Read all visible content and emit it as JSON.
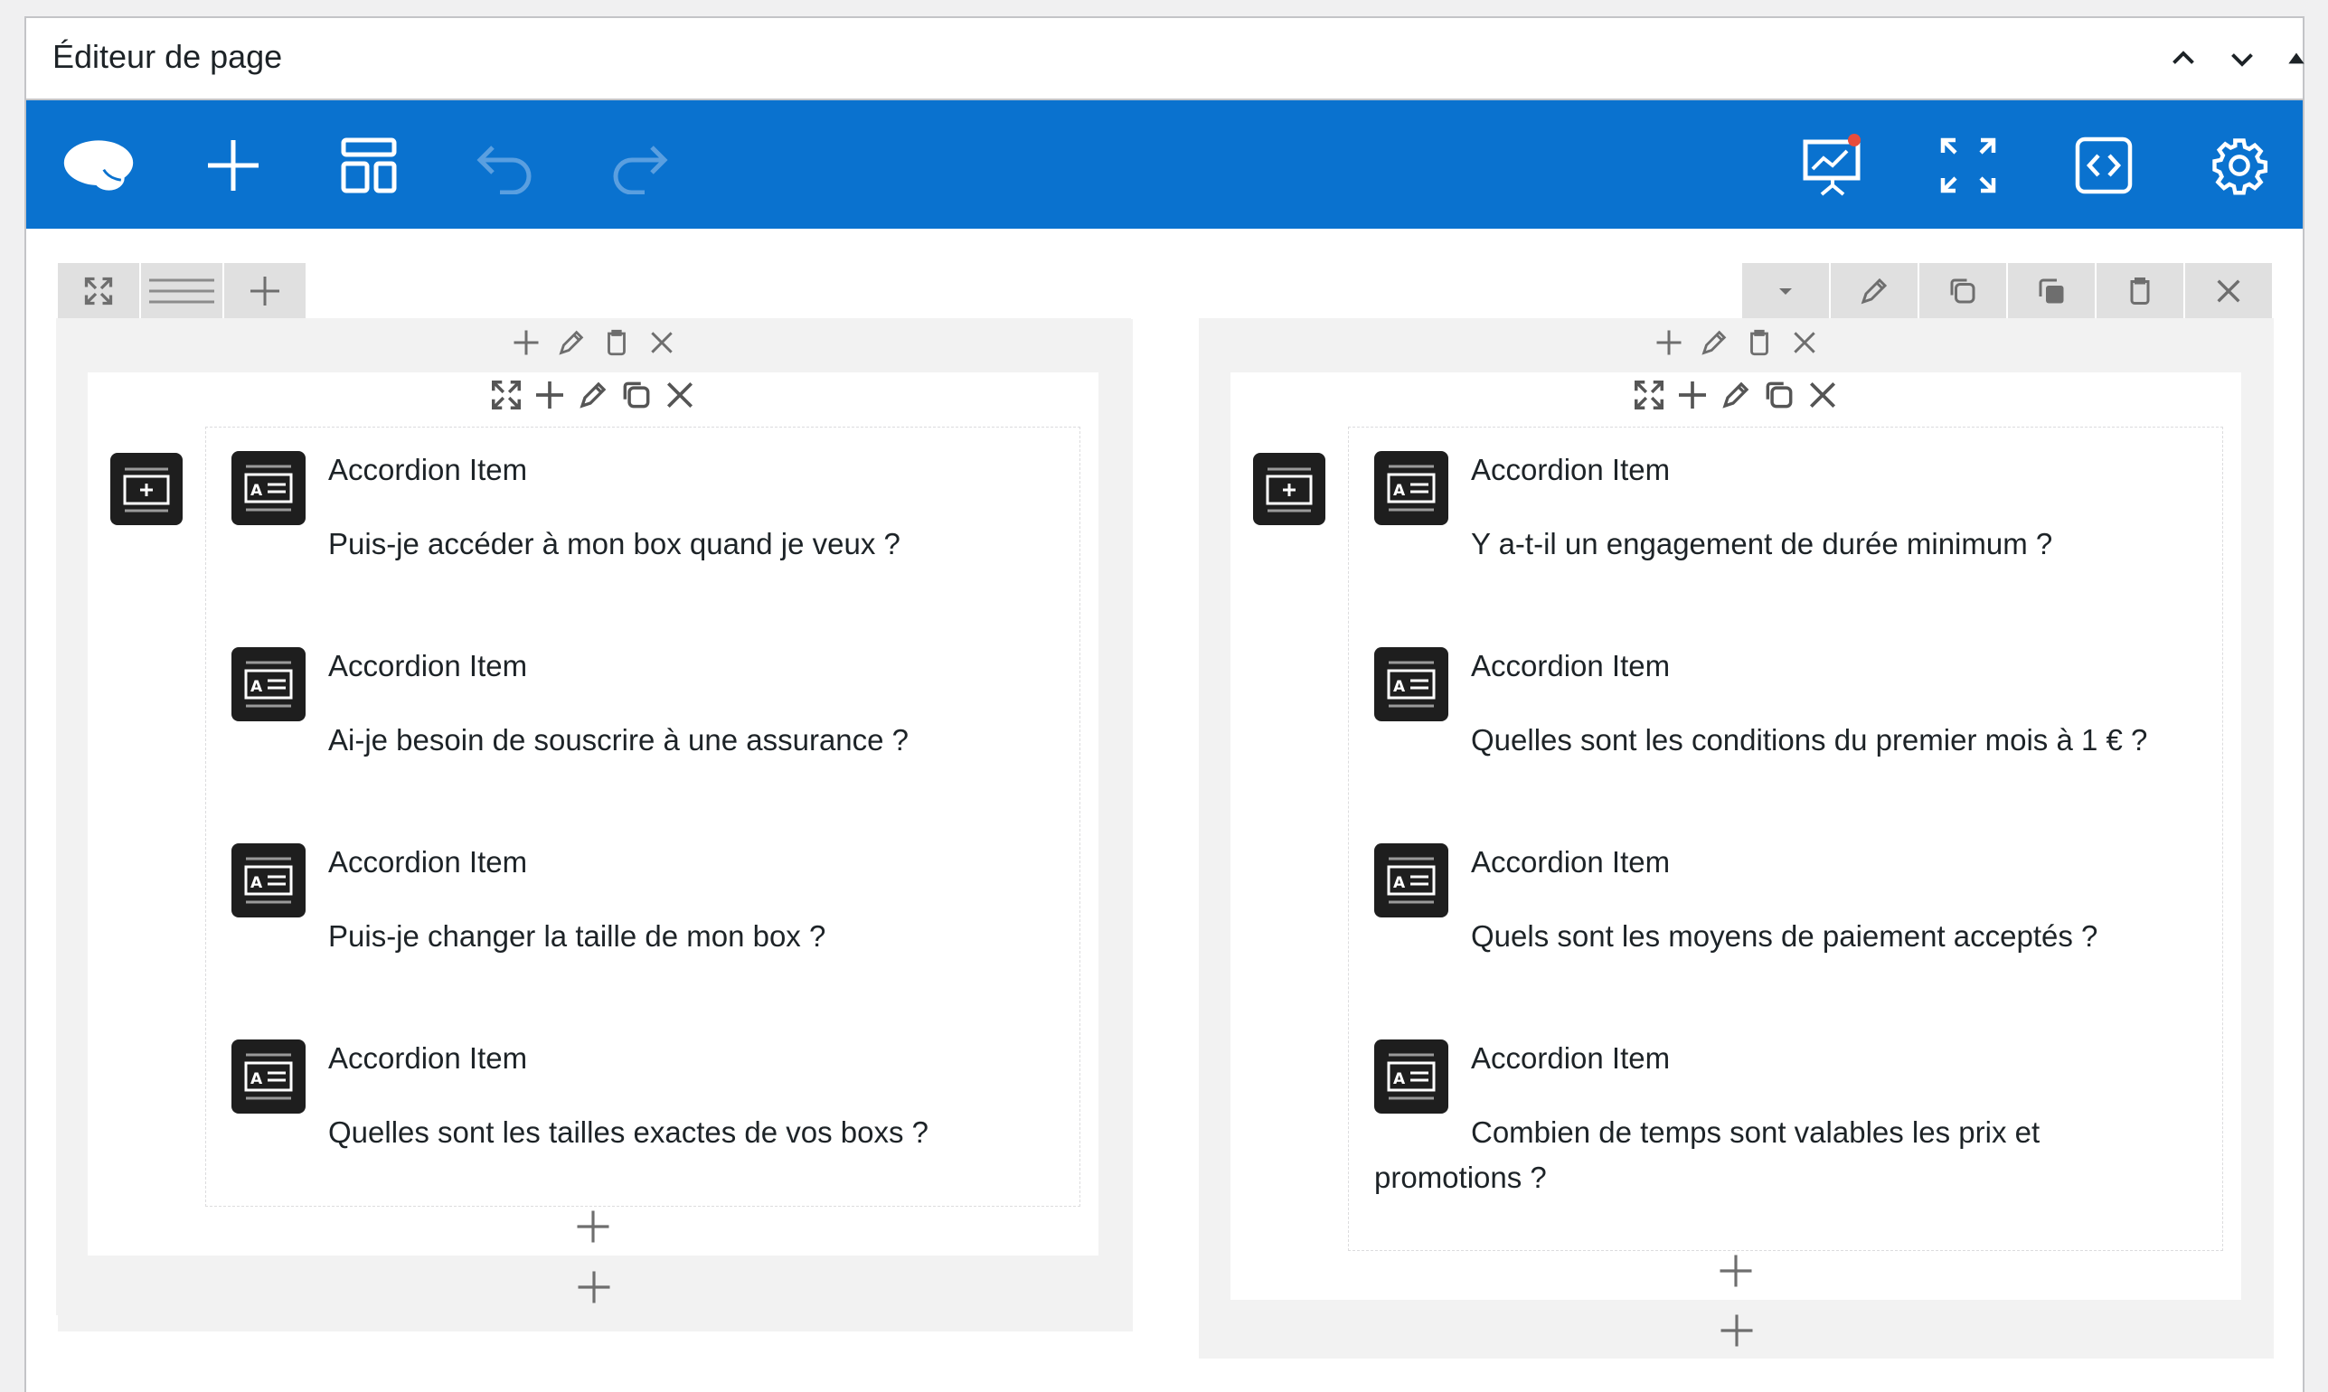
{
  "panel": {
    "title": "Éditeur de page"
  },
  "header_buttons": {
    "up": "chevron-up-icon",
    "down": "chevron-down-icon",
    "toggle": "triangle-up-icon"
  },
  "toolbar": {
    "accent": "#0a72cf",
    "left_icons": [
      "cloud-logo-icon",
      "add-icon",
      "layout-icon",
      "undo-icon",
      "redo-icon"
    ],
    "right_icons": [
      "analytics-icon",
      "fullscreen-icon",
      "code-icon",
      "settings-icon"
    ],
    "notification_color": "#e74c3c"
  },
  "columns": [
    {
      "items": [
        {
          "title": "Accordion Item",
          "question": "Puis-je accéder à mon box quand je veux ?"
        },
        {
          "title": "Accordion Item",
          "question": "Ai-je besoin de souscrire à une assurance ?"
        },
        {
          "title": "Accordion Item",
          "question": "Puis-je changer la taille de mon box ?"
        },
        {
          "title": "Accordion Item",
          "question": "Quelles sont les tailles exactes de vos boxs ?"
        }
      ]
    },
    {
      "items": [
        {
          "title": "Accordion Item",
          "question": "Y a-t-il un engagement de durée minimum ?"
        },
        {
          "title": "Accordion Item",
          "question": "Quelles sont les conditions du premier mois à 1 € ?"
        },
        {
          "title": "Accordion Item",
          "question": "Quels sont les moyens de paiement acceptés ?"
        },
        {
          "title": "Accordion Item",
          "question": "Combien de temps sont valables les prix et promotions ?"
        }
      ]
    }
  ]
}
